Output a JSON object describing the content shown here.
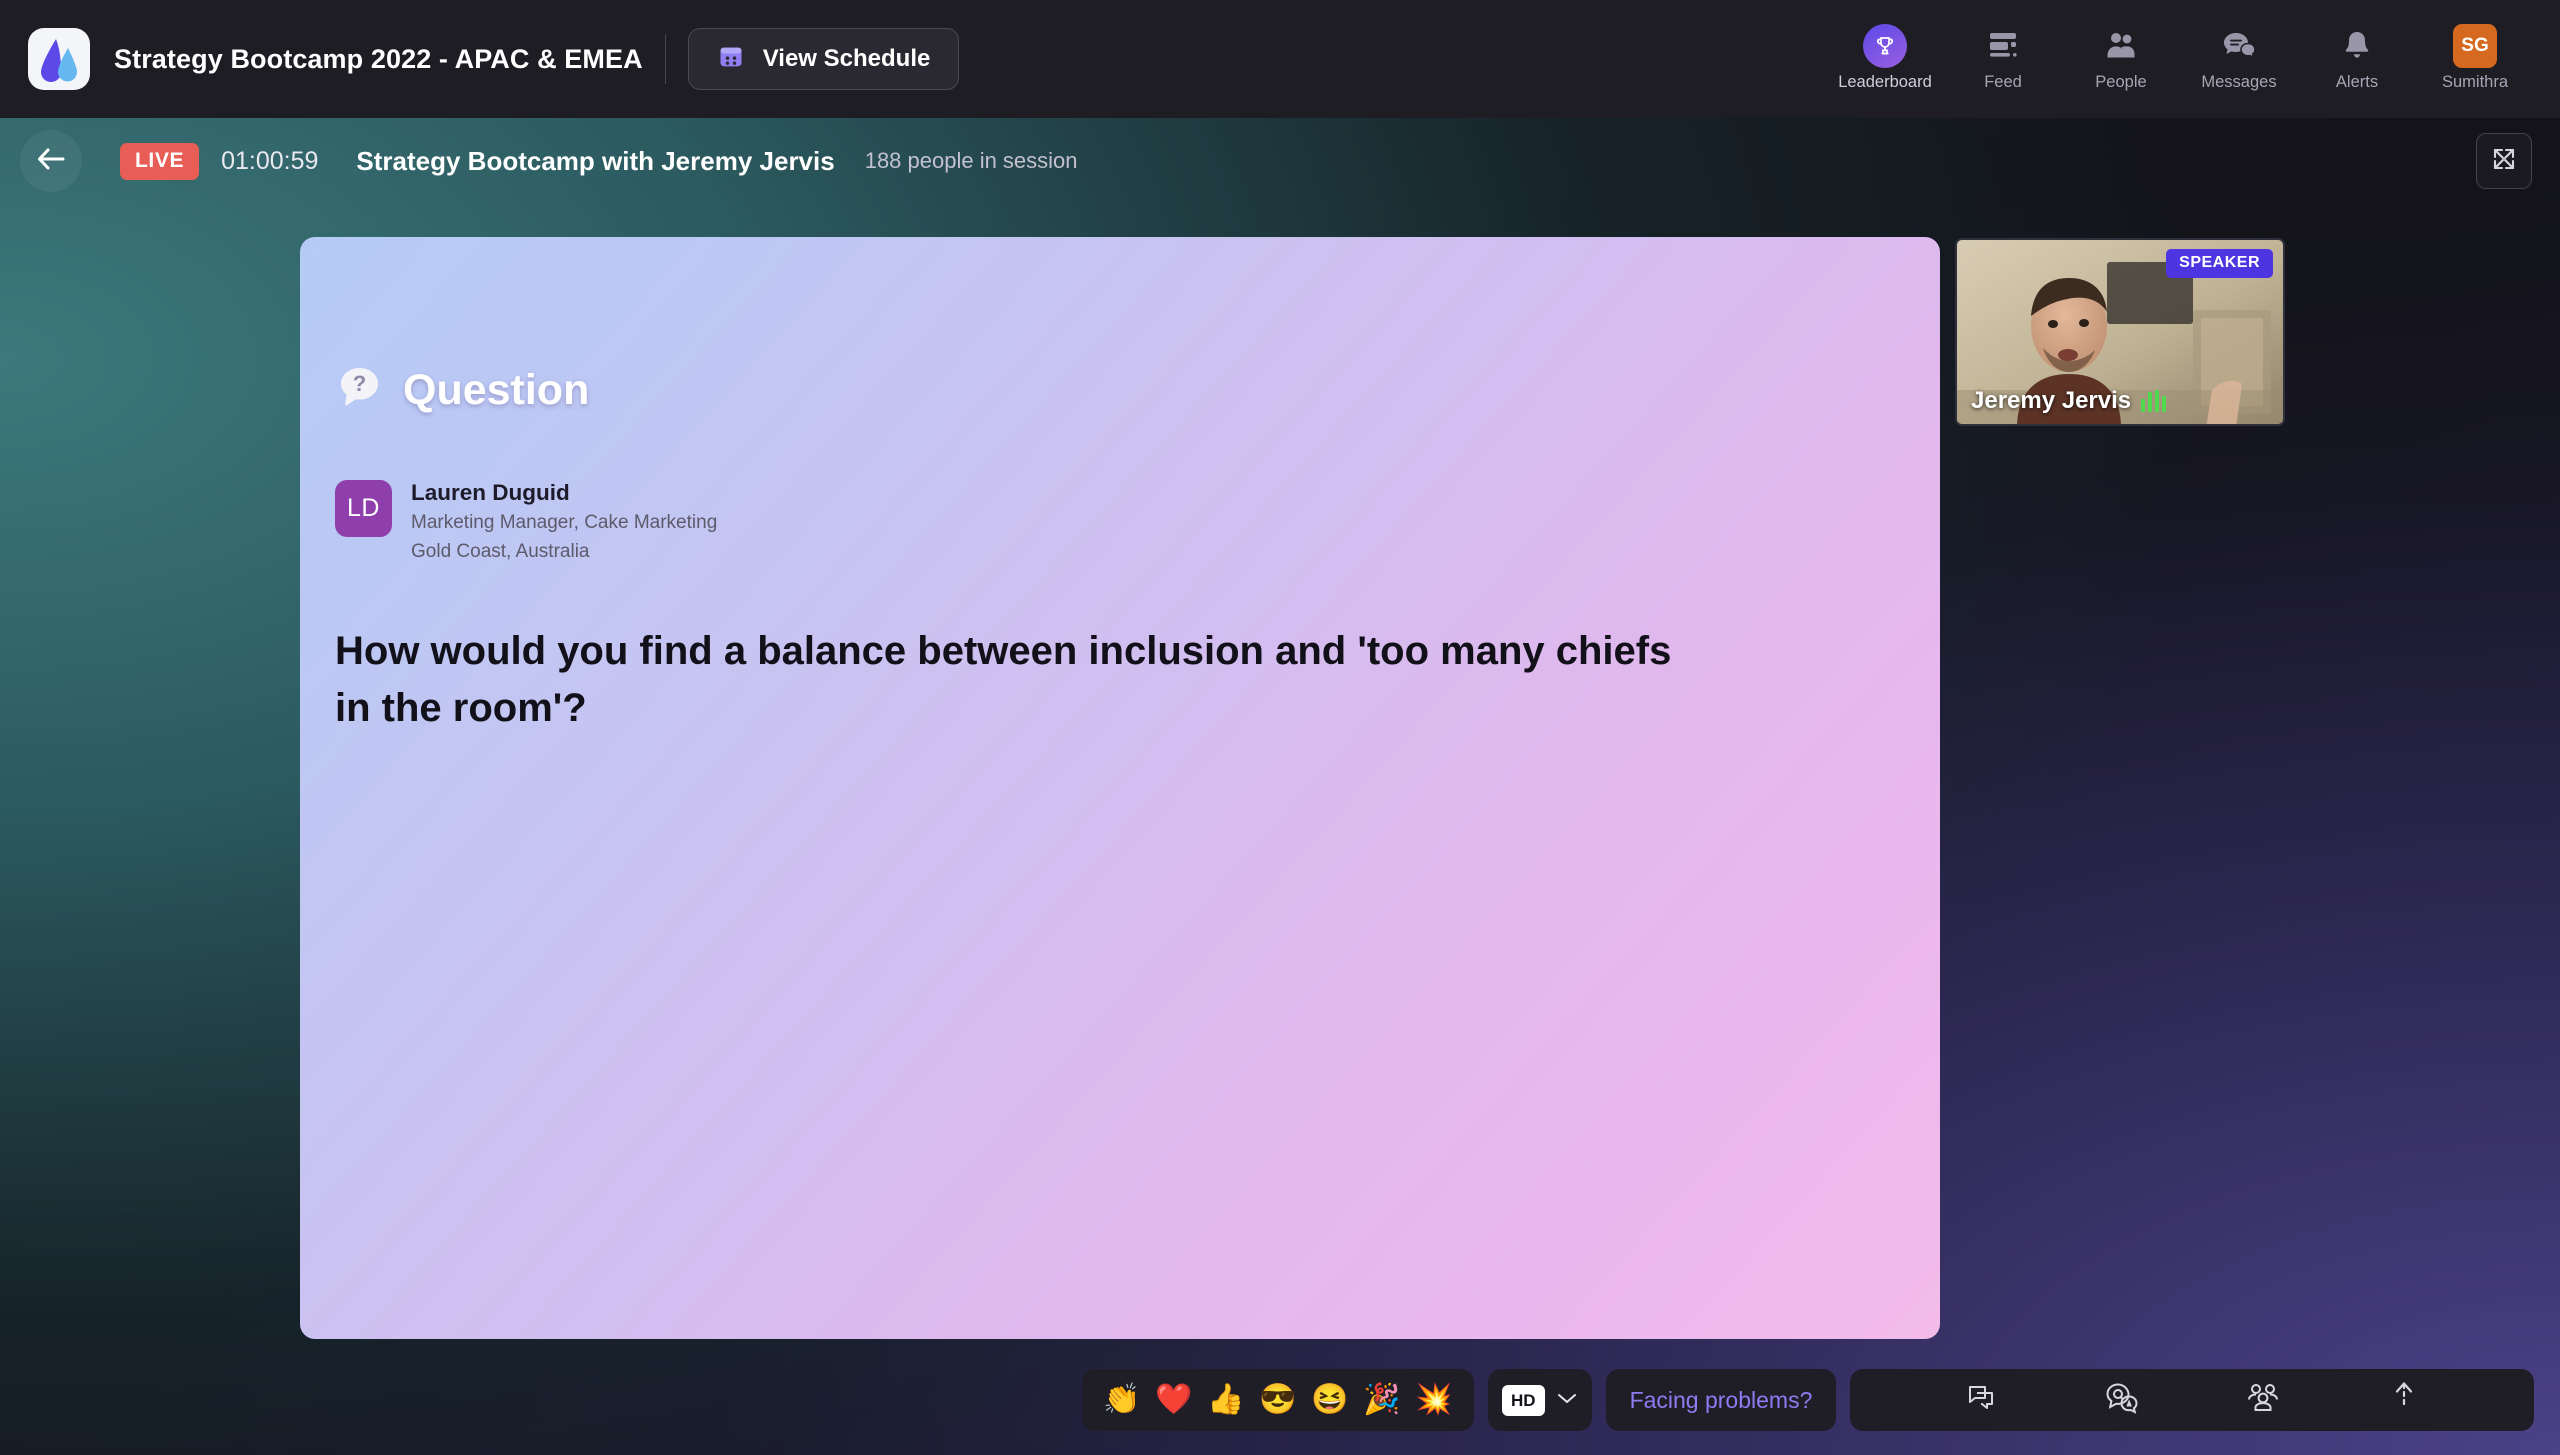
{
  "header": {
    "logo_icon": "app-logo-droplet",
    "event_title": "Strategy Bootcamp 2022 - APAC & EMEA",
    "schedule_button": {
      "label": "View Schedule",
      "icon": "calendar-icon"
    },
    "nav": [
      {
        "label": "Leaderboard",
        "icon": "trophy-icon",
        "active": true
      },
      {
        "label": "Feed",
        "icon": "feed-icon",
        "active": false
      },
      {
        "label": "People",
        "icon": "people-icon",
        "active": false
      },
      {
        "label": "Messages",
        "icon": "messages-icon",
        "active": false
      },
      {
        "label": "Alerts",
        "icon": "bell-icon",
        "active": false
      },
      {
        "label": "Sumithra",
        "icon": "avatar-initials",
        "initials": "SG",
        "active": false
      }
    ],
    "avatar_color": "#d4691f",
    "background": "#1e1d24"
  },
  "session": {
    "back_icon": "back-arrow-icon",
    "live_label": "LIVE",
    "live_color": "#e85d55",
    "timer": "01:00:59",
    "title": "Strategy Bootcamp with Jeremy Jervis",
    "attendees": "188 people in session",
    "fullscreen_icon": "fullscreen-expand-icon"
  },
  "question_card": {
    "heading": "Question",
    "heading_icon": "question-bubble-icon",
    "author": {
      "initials": "LD",
      "avatar_color": "#8e3fab",
      "name": "Lauren Duguid",
      "role": "Marketing Manager, Cake Marketing",
      "location": "Gold Coast, Australia"
    },
    "text": "How would you find a balance between inclusion and 'too many chiefs in the room'?",
    "gradient_from": "#b5cbf6",
    "gradient_to": "#f2bbe9"
  },
  "speaker_tile": {
    "badge": "SPEAKER",
    "badge_color": "#4e35e2",
    "name": "Jeremy Jervis",
    "audio_icon": "audio-level-bars",
    "audio_color": "#4ddb4d"
  },
  "toolbar": {
    "reactions": [
      {
        "name": "clap-reaction",
        "glyph": "👏"
      },
      {
        "name": "heart-reaction",
        "glyph": "❤️"
      },
      {
        "name": "thumbs-up-reaction",
        "glyph": "👍"
      },
      {
        "name": "cool-reaction",
        "glyph": "😎"
      },
      {
        "name": "laugh-reaction",
        "glyph": "😆"
      },
      {
        "name": "party-popper-reaction",
        "glyph": "🎉"
      },
      {
        "name": "wow-reaction",
        "glyph": "💥"
      }
    ],
    "quality": {
      "label": "HD",
      "chevron_icon": "chevron-down-icon"
    },
    "help_label": "Facing problems?",
    "help_color": "#8d7bf2",
    "right_tools": [
      {
        "name": "chat-icon"
      },
      {
        "name": "qa-icon"
      },
      {
        "name": "participants-icon"
      },
      {
        "name": "share-up-icon"
      }
    ]
  }
}
